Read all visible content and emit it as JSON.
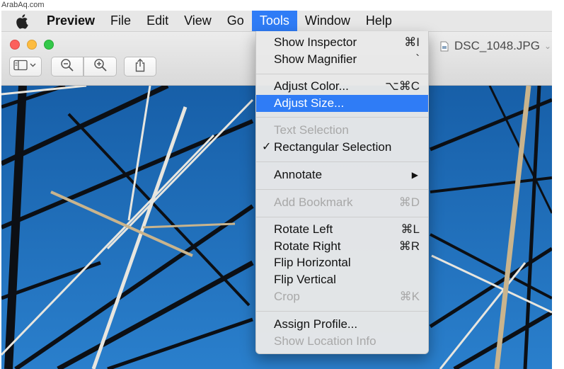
{
  "watermark": "ArabAq.com",
  "menubar": {
    "app_name": "Preview",
    "items": [
      "File",
      "Edit",
      "View",
      "Go",
      "Tools",
      "Window",
      "Help"
    ],
    "active": "Tools"
  },
  "window": {
    "document_title": "DSC_1048.JPG"
  },
  "tools_menu": {
    "show_inspector": {
      "label": "Show Inspector",
      "shortcut": "⌘I"
    },
    "show_magnifier": {
      "label": "Show Magnifier",
      "shortcut": "`"
    },
    "adjust_color": {
      "label": "Adjust Color...",
      "shortcut": "⌥⌘C"
    },
    "adjust_size": {
      "label": "Adjust Size..."
    },
    "text_selection": {
      "label": "Text Selection"
    },
    "rectangular_selection": {
      "label": "Rectangular Selection",
      "check": "✓"
    },
    "annotate": {
      "label": "Annotate",
      "arrow": "▶"
    },
    "add_bookmark": {
      "label": "Add Bookmark",
      "shortcut": "⌘D"
    },
    "rotate_left": {
      "label": "Rotate Left",
      "shortcut": "⌘L"
    },
    "rotate_right": {
      "label": "Rotate Right",
      "shortcut": "⌘R"
    },
    "flip_horizontal": {
      "label": "Flip Horizontal"
    },
    "flip_vertical": {
      "label": "Flip Vertical"
    },
    "crop": {
      "label": "Crop",
      "shortcut": "⌘K"
    },
    "assign_profile": {
      "label": "Assign Profile..."
    },
    "show_location_info": {
      "label": "Show Location Info"
    }
  },
  "colors": {
    "menu_highlight": "#2f7cf6",
    "sky": "#1f6fb8",
    "disabled_text": "#a8a8a8"
  },
  "icons": [
    "apple-logo",
    "sidebar-toggle-icon",
    "zoom-out-icon",
    "zoom-in-icon",
    "share-icon",
    "jpg-file-icon"
  ]
}
